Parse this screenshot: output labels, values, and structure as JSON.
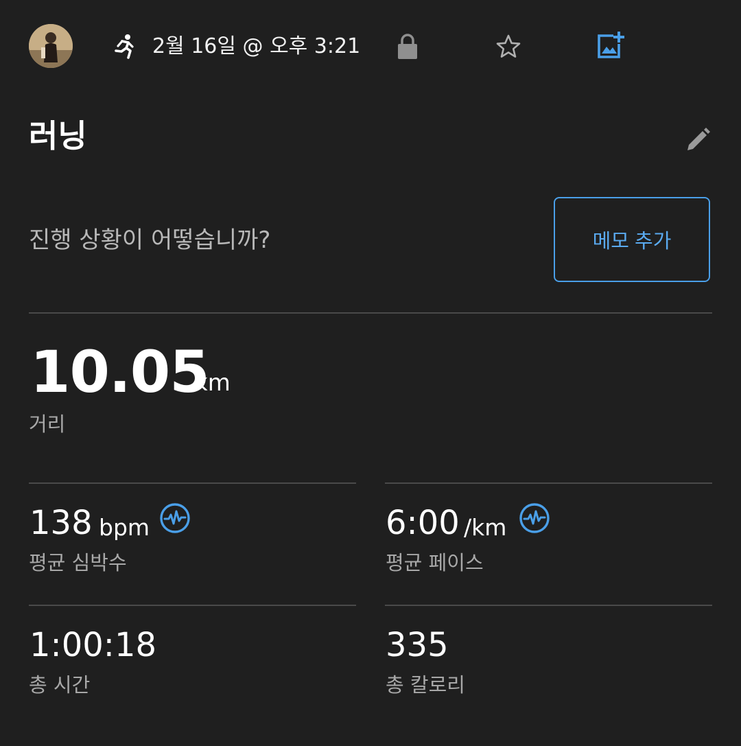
{
  "header": {
    "datetime": "2월 16일 @ 오후 3:21",
    "icons": {
      "activity": "running-icon",
      "privacy": "lock-icon",
      "favorite": "star-icon",
      "add_photo": "add-photo-icon"
    },
    "accent_color": "#4a9fe8"
  },
  "activity": {
    "title": "러닝",
    "prompt": "진행 상황이 어떻습니까?",
    "memo_button": "메모 추가"
  },
  "distance": {
    "value": "10.05",
    "unit": "km",
    "label": "거리"
  },
  "stats": {
    "avg_hr": {
      "value": "138",
      "unit": "bpm",
      "label": "평균 심박수"
    },
    "avg_pace": {
      "value": "6:00",
      "unit": "/km",
      "label": "평균 페이스"
    },
    "total_time": {
      "value": "1:00:18",
      "label": "총 시간"
    },
    "total_calories": {
      "value": "335",
      "label": "총 칼로리"
    }
  }
}
